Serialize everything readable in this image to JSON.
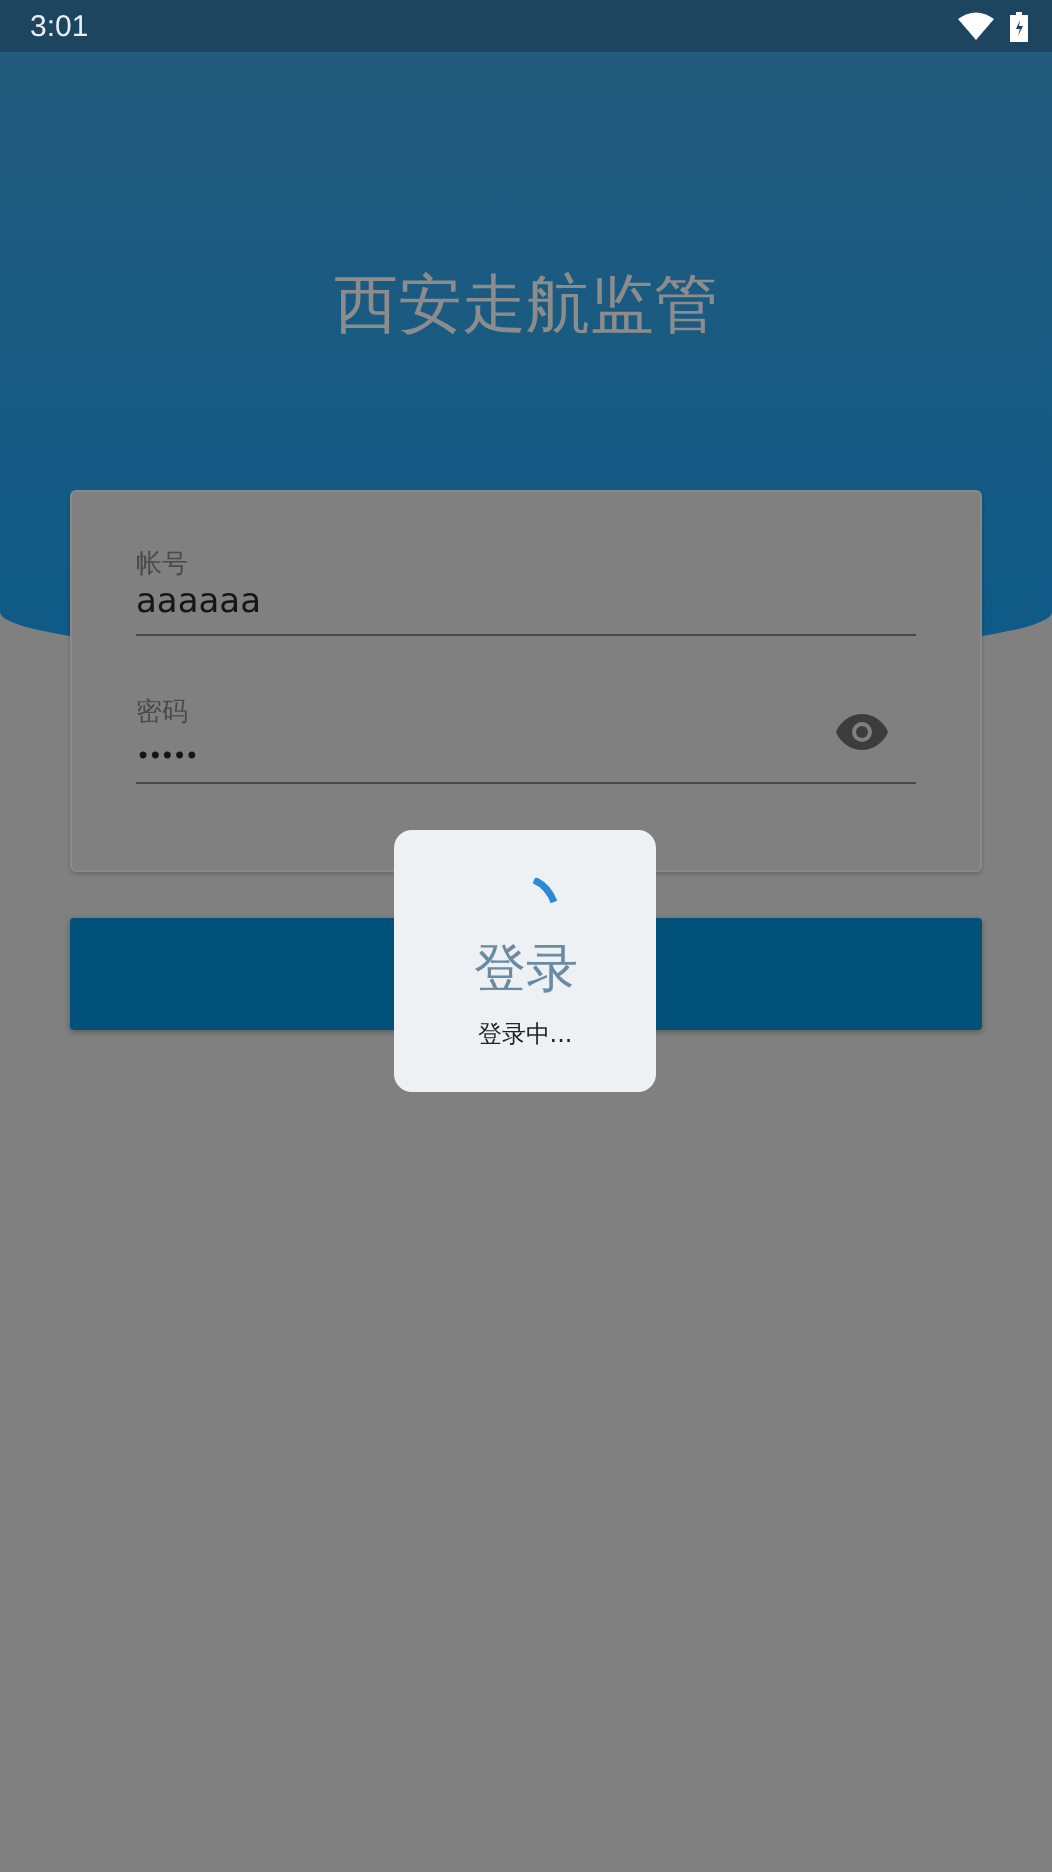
{
  "status_bar": {
    "time": "3:01"
  },
  "title": "西安走航监管",
  "fields": [
    {
      "kind": "text",
      "label": "帐号",
      "value": "aaaaaa"
    },
    {
      "kind": "password",
      "label": "密码",
      "value": "•••••"
    }
  ],
  "login_button": {
    "label": "登录"
  },
  "loading_dialog": {
    "message": "登录中..."
  }
}
